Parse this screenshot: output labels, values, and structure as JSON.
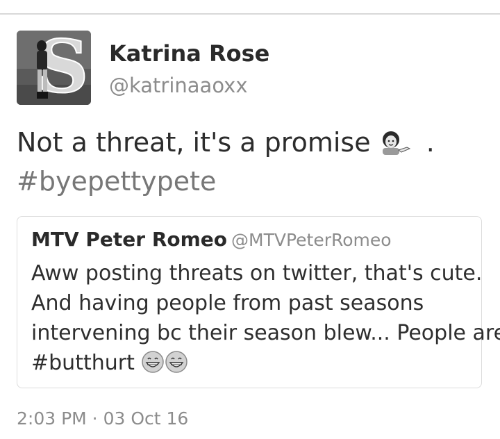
{
  "tweet": {
    "author": {
      "display_name": "Katrina Rose",
      "handle": "@katrinaaoxx"
    },
    "text_line1": "Not a threat, it's a promise",
    "text_line1_suffix": " .",
    "hashtag": "#byepettypete",
    "timestamp": "2:03 PM · 03 Oct 16"
  },
  "quoted_tweet": {
    "display_name": "MTV Peter Romeo",
    "handle": "@MTVPeterRomeo",
    "lines": [
      "Aww posting threats on twitter, that's cute.",
      "And having people from past seasons",
      "intervening bc their season blew... People are"
    ],
    "hashtag": "#butthurt"
  },
  "icons": {
    "inline_emoji": "information-desk-person-emoji",
    "quote_emojis": [
      "grinning-face-emoji",
      "grinning-face-emoji"
    ]
  }
}
